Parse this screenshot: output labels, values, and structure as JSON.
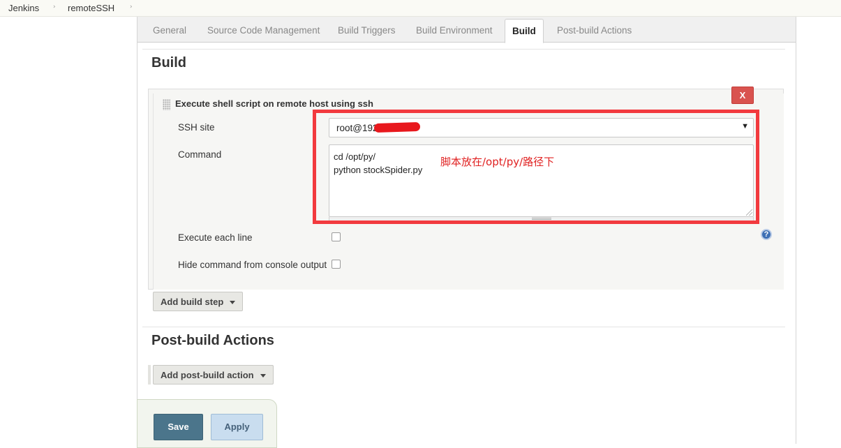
{
  "breadcrumb": {
    "items": [
      "Jenkins",
      "remoteSSH"
    ],
    "separator": "›"
  },
  "tabs": [
    {
      "label": "General",
      "active": false
    },
    {
      "label": "Source Code Management",
      "active": false
    },
    {
      "label": "Build Triggers",
      "active": false
    },
    {
      "label": "Build Environment",
      "active": false
    },
    {
      "label": "Build",
      "active": true
    },
    {
      "label": "Post-build Actions",
      "active": false
    }
  ],
  "build": {
    "title": "Build",
    "step": {
      "title": "Execute shell script on remote host using ssh",
      "delete_label": "X",
      "ssh_site_label": "SSH site",
      "ssh_site_value": "root@192.         :22",
      "command_label": "Command",
      "command_lines": [
        "cd /opt/py/",
        "python stockSpider.py"
      ],
      "annotation": "脚本放在/opt/py/路径下",
      "execute_each_line_label": "Execute each line",
      "execute_each_line_checked": false,
      "hide_command_label": "Hide command from console output",
      "hide_command_checked": false,
      "help_icon": "?"
    },
    "add_step_label": "Add build step"
  },
  "post_build": {
    "title": "Post-build Actions",
    "add_action_label": "Add post-build action"
  },
  "actions": {
    "save_label": "Save",
    "apply_label": "Apply"
  },
  "colors": {
    "annotation_red": "#f23a3e",
    "save_bg": "#4b758b",
    "apply_bg": "#c9ddef",
    "delete_bg": "#d9534f"
  }
}
